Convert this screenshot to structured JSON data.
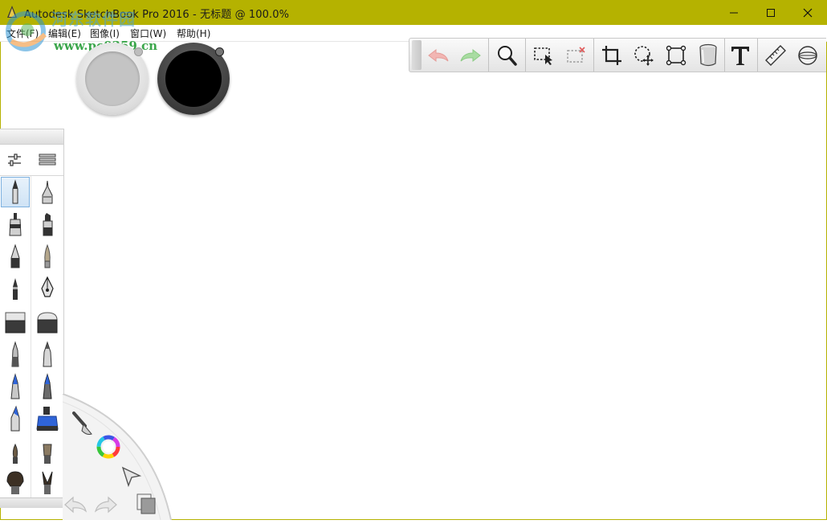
{
  "window": {
    "title": "Autodesk SketchBook Pro 2016 - 无标题 @ 100.0%",
    "minimize_label": "—",
    "maximize_label": "☐",
    "close_label": "✕"
  },
  "menu": {
    "items": [
      "文件(F)",
      "编辑(E)",
      "图像(I)",
      "窗口(W)",
      "帮助(H)"
    ]
  },
  "watermark": {
    "site_name": "河东软件园",
    "url": "www.pc0359.cn"
  },
  "toolbar": {
    "tools": [
      {
        "name": "undo",
        "icon": "undo-arrow-icon"
      },
      {
        "name": "redo",
        "icon": "redo-arrow-icon"
      },
      {
        "name": "zoom",
        "icon": "magnifier-icon"
      },
      {
        "name": "select",
        "icon": "marquee-select-icon"
      },
      {
        "name": "deselect",
        "icon": "deselect-icon"
      },
      {
        "name": "crop",
        "icon": "crop-icon"
      },
      {
        "name": "lasso-move",
        "icon": "lasso-move-icon"
      },
      {
        "name": "transform",
        "icon": "transform-icon"
      },
      {
        "name": "fill",
        "icon": "paint-bucket-icon"
      },
      {
        "name": "text",
        "icon": "text-icon",
        "label": "T"
      },
      {
        "name": "ruler",
        "icon": "ruler-icon"
      },
      {
        "name": "ellipse",
        "icon": "ellipse-guide-icon"
      }
    ]
  },
  "colors": {
    "secondary": "#c4c4c4",
    "primary": "#000000",
    "titlebar": "#b5b200"
  },
  "brush_palette": {
    "tools": [
      "brush-properties-icon",
      "brush-library-icon"
    ],
    "brushes": [
      "pencil",
      "technical-pen",
      "marker",
      "chisel-marker",
      "ballpoint-pen",
      "fine-brush",
      "felt-pen",
      "calligraphy-nib",
      "hard-eraser",
      "soft-eraser",
      "airbrush",
      "airbrush-soft",
      "blue-marker",
      "blue-pen",
      "blue-airbrush",
      "ink-bottle",
      "paint-brush",
      "flat-brush",
      "fan-brush",
      "detail-brush"
    ],
    "selected": "pencil"
  },
  "lagoon": {
    "items": [
      "brush-icon",
      "color-wheel-icon",
      "pointer-icon",
      "layers-icon",
      "undo-icon",
      "redo-icon"
    ]
  }
}
